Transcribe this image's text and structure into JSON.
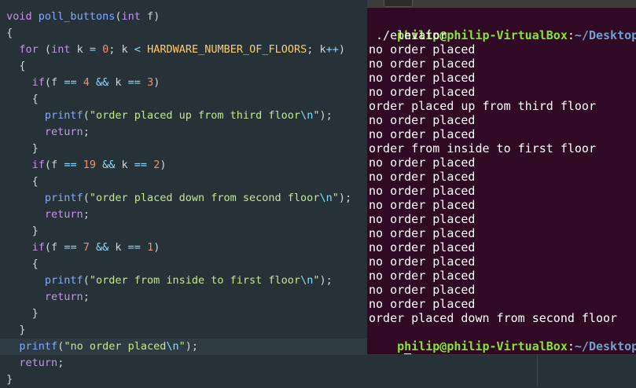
{
  "editor": {
    "lines": [
      {
        "parts": [
          [
            "type",
            "void"
          ],
          [
            "ws",
            " "
          ],
          [
            "fn",
            "poll_buttons"
          ],
          [
            "punc",
            "("
          ],
          [
            "type",
            "int"
          ],
          [
            "ws",
            " f)"
          ]
        ]
      },
      {
        "parts": [
          [
            "punc",
            "{"
          ]
        ]
      },
      {
        "parts": [
          [
            "ws",
            "  "
          ],
          [
            "kw",
            "for"
          ],
          [
            "ws",
            " ("
          ],
          [
            "type",
            "int"
          ],
          [
            "ws",
            " k "
          ],
          [
            "op",
            "="
          ],
          [
            "ws",
            " "
          ],
          [
            "num",
            "0"
          ],
          [
            "ws",
            "; k "
          ],
          [
            "op",
            "<"
          ],
          [
            "ws",
            " "
          ],
          [
            "mac",
            "HARDWARE_NUMBER_OF_FLOORS"
          ],
          [
            "ws",
            "; k"
          ],
          [
            "op",
            "++"
          ],
          [
            "ws",
            ")"
          ]
        ]
      },
      {
        "parts": [
          [
            "ws",
            "  {"
          ]
        ]
      },
      {
        "parts": [
          [
            "ws",
            "    "
          ],
          [
            "kw",
            "if"
          ],
          [
            "ws",
            "(f "
          ],
          [
            "op",
            "=="
          ],
          [
            "ws",
            " "
          ],
          [
            "num",
            "4"
          ],
          [
            "ws",
            " "
          ],
          [
            "op",
            "&&"
          ],
          [
            "ws",
            " k "
          ],
          [
            "op",
            "=="
          ],
          [
            "ws",
            " "
          ],
          [
            "num",
            "3"
          ],
          [
            "ws",
            ")"
          ]
        ]
      },
      {
        "parts": [
          [
            "ws",
            "    {"
          ]
        ]
      },
      {
        "parts": [
          [
            "ws",
            "      "
          ],
          [
            "fn",
            "printf"
          ],
          [
            "ws",
            "("
          ],
          [
            "str",
            "\"order placed up from third floor"
          ],
          [
            "esc",
            "\\n"
          ],
          [
            "str",
            "\""
          ],
          [
            "ws",
            ");"
          ]
        ]
      },
      {
        "parts": [
          [
            "ws",
            "      "
          ],
          [
            "kw",
            "return"
          ],
          [
            "ws",
            ";"
          ]
        ]
      },
      {
        "parts": [
          [
            "ws",
            "    }"
          ]
        ]
      },
      {
        "parts": [
          [
            "ws",
            "    "
          ],
          [
            "kw",
            "if"
          ],
          [
            "ws",
            "(f "
          ],
          [
            "op",
            "=="
          ],
          [
            "ws",
            " "
          ],
          [
            "num",
            "19"
          ],
          [
            "ws",
            " "
          ],
          [
            "op",
            "&&"
          ],
          [
            "ws",
            " k "
          ],
          [
            "op",
            "=="
          ],
          [
            "ws",
            " "
          ],
          [
            "num",
            "2"
          ],
          [
            "ws",
            ")"
          ]
        ]
      },
      {
        "parts": [
          [
            "ws",
            "    {"
          ]
        ]
      },
      {
        "parts": [
          [
            "ws",
            "      "
          ],
          [
            "fn",
            "printf"
          ],
          [
            "ws",
            "("
          ],
          [
            "str",
            "\"order placed down from second floor"
          ],
          [
            "esc",
            "\\n"
          ],
          [
            "str",
            "\""
          ],
          [
            "ws",
            ");"
          ]
        ]
      },
      {
        "parts": [
          [
            "ws",
            "      "
          ],
          [
            "kw",
            "return"
          ],
          [
            "ws",
            ";"
          ]
        ]
      },
      {
        "parts": [
          [
            "ws",
            "    }"
          ]
        ]
      },
      {
        "parts": [
          [
            "ws",
            "    "
          ],
          [
            "kw",
            "if"
          ],
          [
            "ws",
            "(f "
          ],
          [
            "op",
            "=="
          ],
          [
            "ws",
            " "
          ],
          [
            "num",
            "7"
          ],
          [
            "ws",
            " "
          ],
          [
            "op",
            "&&"
          ],
          [
            "ws",
            " k "
          ],
          [
            "op",
            "=="
          ],
          [
            "ws",
            " "
          ],
          [
            "num",
            "1"
          ],
          [
            "ws",
            ")"
          ]
        ]
      },
      {
        "parts": [
          [
            "ws",
            "    {"
          ]
        ]
      },
      {
        "parts": [
          [
            "ws",
            "      "
          ],
          [
            "fn",
            "printf"
          ],
          [
            "ws",
            "("
          ],
          [
            "str",
            "\"order from inside to first floor"
          ],
          [
            "esc",
            "\\n"
          ],
          [
            "str",
            "\""
          ],
          [
            "ws",
            ");"
          ]
        ]
      },
      {
        "parts": [
          [
            "ws",
            "      "
          ],
          [
            "kw",
            "return"
          ],
          [
            "ws",
            ";"
          ]
        ]
      },
      {
        "parts": [
          [
            "ws",
            "    }"
          ]
        ]
      },
      {
        "parts": [
          [
            "ws",
            "  }"
          ]
        ]
      },
      {
        "parts": [
          [
            "ws",
            "  "
          ],
          [
            "fn",
            "printf"
          ],
          [
            "ws",
            "("
          ],
          [
            "str",
            "\"no order placed"
          ],
          [
            "esc",
            "\\n"
          ],
          [
            "str",
            "\""
          ],
          [
            "ws",
            ");"
          ]
        ],
        "active": true
      },
      {
        "parts": [
          [
            "ws",
            "  "
          ],
          [
            "kw",
            "return"
          ],
          [
            "ws",
            ";"
          ]
        ]
      },
      {
        "parts": [
          [
            "punc",
            "}"
          ]
        ]
      }
    ]
  },
  "terminal": {
    "prompt": {
      "user": "philip@philip-VirtualBox",
      "sep": ":",
      "path": "~/Desktop/tes"
    },
    "command": " ./elevator",
    "output": [
      "no order placed",
      "no order placed",
      "no order placed",
      "no order placed",
      "order placed up from third floor",
      "no order placed",
      "no order placed",
      "order from inside to first floor",
      "no order placed",
      "no order placed",
      "no order placed",
      "no order placed",
      "no order placed",
      "no order placed",
      "no order placed",
      "no order placed",
      "no order placed",
      "no order placed",
      "no order placed",
      "order placed down from second floor"
    ]
  },
  "colors": {
    "editor_bg": "#263238",
    "terminal_bg": "#300a24",
    "prompt_user": "#8ae234",
    "prompt_path": "#729fcf"
  }
}
